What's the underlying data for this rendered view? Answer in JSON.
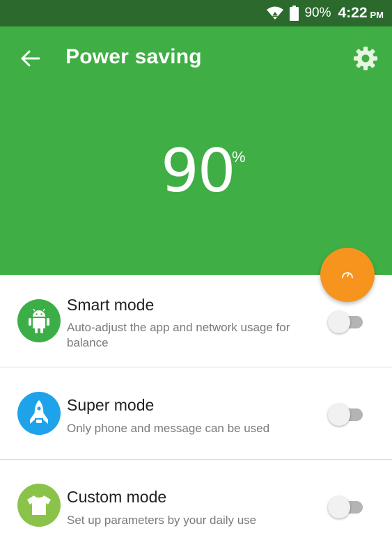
{
  "status_bar": {
    "battery_text": "90%",
    "time": "4:22",
    "ampm": "PM",
    "icons": [
      "wifi-icon",
      "battery-icon"
    ]
  },
  "header": {
    "title": "Power saving",
    "back_icon": "arrow-left-icon",
    "settings_icon": "gear-icon",
    "background": "#3fae44"
  },
  "battery": {
    "value": "90",
    "unit": "%"
  },
  "fab": {
    "icon": "speedometer-icon",
    "color": "#f7941d"
  },
  "modes": [
    {
      "title": "Smart mode",
      "description": "Auto-adjust the app and network usage for balance",
      "icon": "android-icon",
      "icon_color": "#3cae47",
      "enabled": false
    },
    {
      "title": "Super mode",
      "description": "Only phone and message can be used",
      "icon": "rocket-icon",
      "icon_color": "#1ea3ea",
      "enabled": false
    },
    {
      "title": "Custom mode",
      "description": "Set up parameters by your daily use",
      "icon": "tshirt-icon",
      "icon_color": "#8bc34a",
      "enabled": false
    }
  ]
}
